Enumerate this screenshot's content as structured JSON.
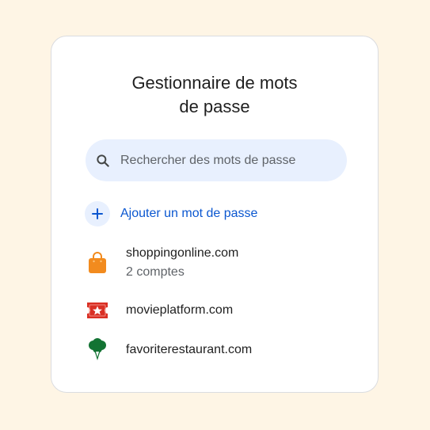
{
  "window": {
    "title_line1": "Gestionnaire de mots",
    "title_line2": "de passe"
  },
  "search": {
    "placeholder": "Rechercher des mots de passe",
    "icon": "search-icon"
  },
  "add": {
    "label": "Ajouter un mot de passe",
    "icon": "plus-icon"
  },
  "sites": [
    {
      "name": "shoppingonline.com",
      "sub": "2 comptes",
      "icon": "shopping-bag-icon"
    },
    {
      "name": "movieplatform.com",
      "sub": "",
      "icon": "movie-ticket-icon"
    },
    {
      "name": "favoriterestaurant.com",
      "sub": "",
      "icon": "broccoli-icon"
    }
  ],
  "colors": {
    "background": "#fef5e5",
    "accent": "#0b57d0",
    "search_bg": "#e8f0fe",
    "shopping": "#f28b1e",
    "movie": "#d93025",
    "restaurant": "#137333"
  }
}
